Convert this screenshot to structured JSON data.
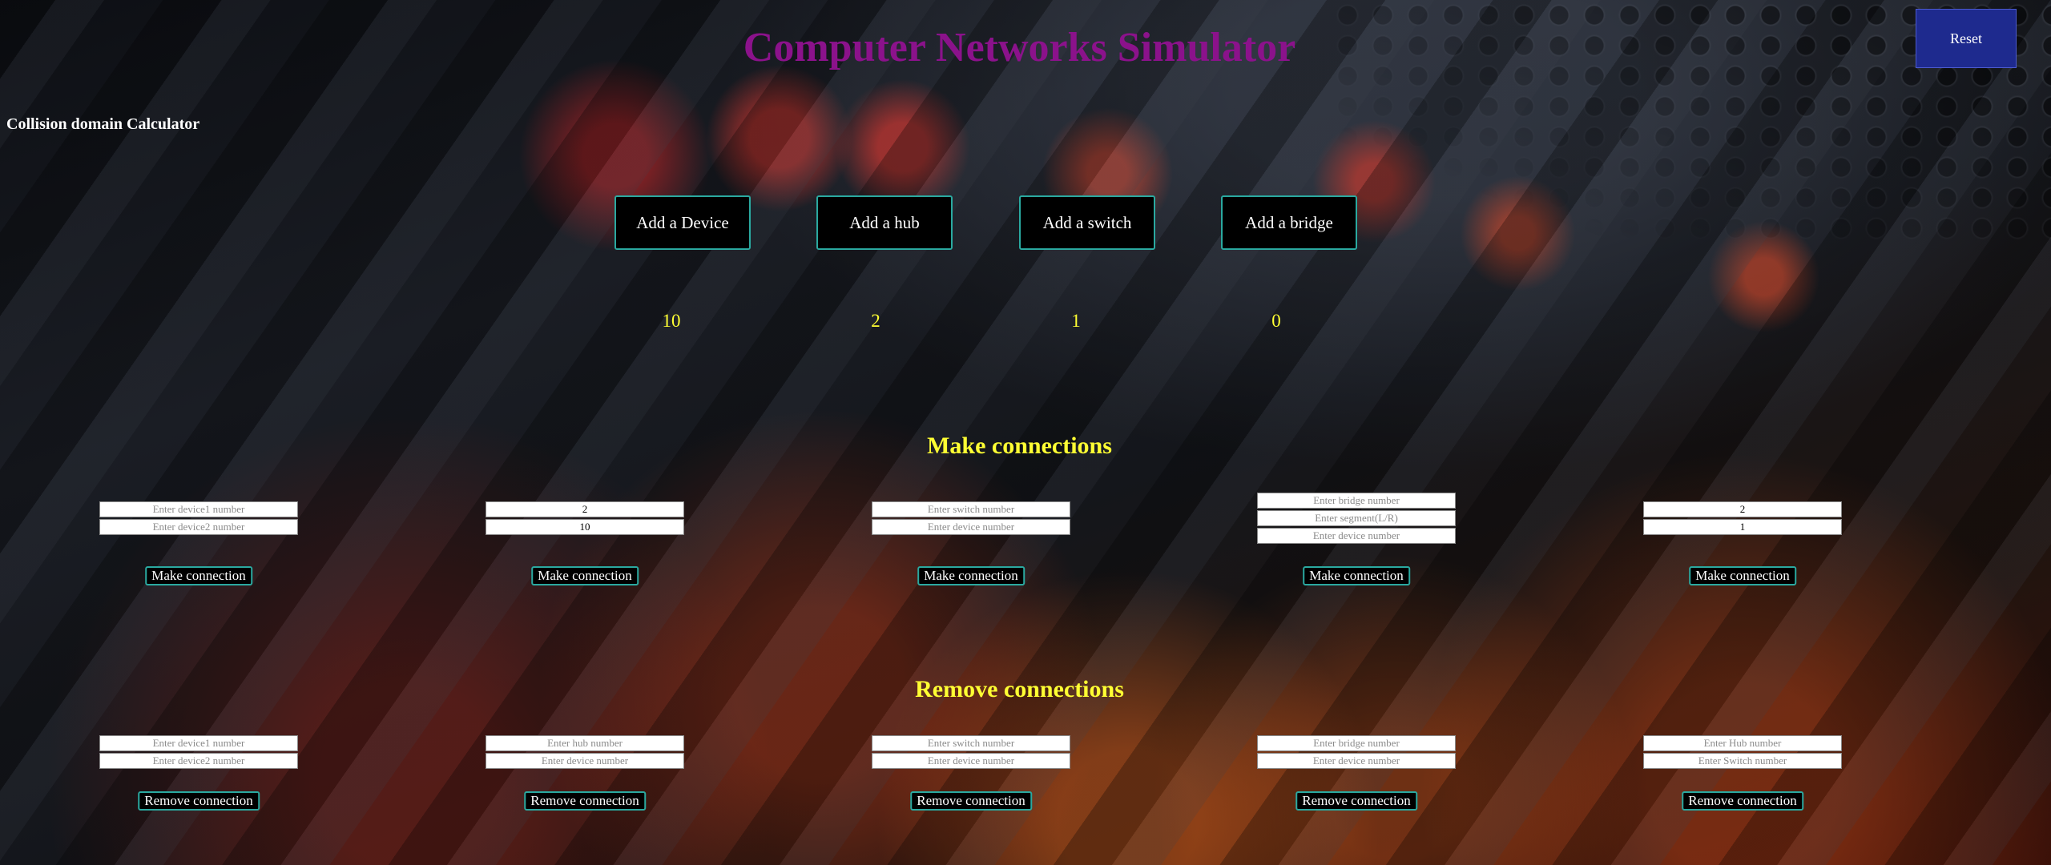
{
  "header": {
    "title": "Computer Networks Simulator",
    "side_title": "Collision domain Calculator",
    "reset_label": "Reset"
  },
  "add_buttons": [
    {
      "label": "Add a Device",
      "count": "10"
    },
    {
      "label": "Add a hub",
      "count": "2"
    },
    {
      "label": "Add a switch",
      "count": "1"
    },
    {
      "label": "Add a bridge",
      "count": "0"
    }
  ],
  "make": {
    "title": "Make connections",
    "button_label": "Make connection",
    "panels": [
      {
        "fields": [
          {
            "placeholder": "Enter device1 number",
            "value": ""
          },
          {
            "placeholder": "Enter device2 number",
            "value": ""
          }
        ]
      },
      {
        "fields": [
          {
            "placeholder": "",
            "value": "2"
          },
          {
            "placeholder": "",
            "value": "10"
          }
        ]
      },
      {
        "fields": [
          {
            "placeholder": "Enter switch number",
            "value": ""
          },
          {
            "placeholder": "Enter device number",
            "value": ""
          }
        ]
      },
      {
        "fields": [
          {
            "placeholder": "Enter bridge number",
            "value": ""
          },
          {
            "placeholder": "Enter segment(L/R)",
            "value": ""
          },
          {
            "placeholder": "Enter device number",
            "value": ""
          }
        ]
      },
      {
        "fields": [
          {
            "placeholder": "",
            "value": "2"
          },
          {
            "placeholder": "",
            "value": "1"
          }
        ]
      }
    ]
  },
  "remove": {
    "title": "Remove connections",
    "button_label": "Remove connection",
    "panels": [
      {
        "fields": [
          {
            "placeholder": "Enter device1 number",
            "value": ""
          },
          {
            "placeholder": "Enter device2 number",
            "value": ""
          }
        ]
      },
      {
        "fields": [
          {
            "placeholder": "Enter hub number",
            "value": ""
          },
          {
            "placeholder": "Enter device number",
            "value": ""
          }
        ]
      },
      {
        "fields": [
          {
            "placeholder": "Enter switch number",
            "value": ""
          },
          {
            "placeholder": "Enter device number",
            "value": ""
          }
        ]
      },
      {
        "fields": [
          {
            "placeholder": "Enter bridge number",
            "value": ""
          },
          {
            "placeholder": "Enter device number",
            "value": ""
          }
        ]
      },
      {
        "fields": [
          {
            "placeholder": "Enter Hub number",
            "value": ""
          },
          {
            "placeholder": "Enter Switch number",
            "value": ""
          }
        ]
      }
    ]
  },
  "colors": {
    "title": "#8b128b",
    "accent_yellow": "#ffff33",
    "button_border": "#2aa9a0",
    "reset_bg": "#1e2a8e"
  }
}
